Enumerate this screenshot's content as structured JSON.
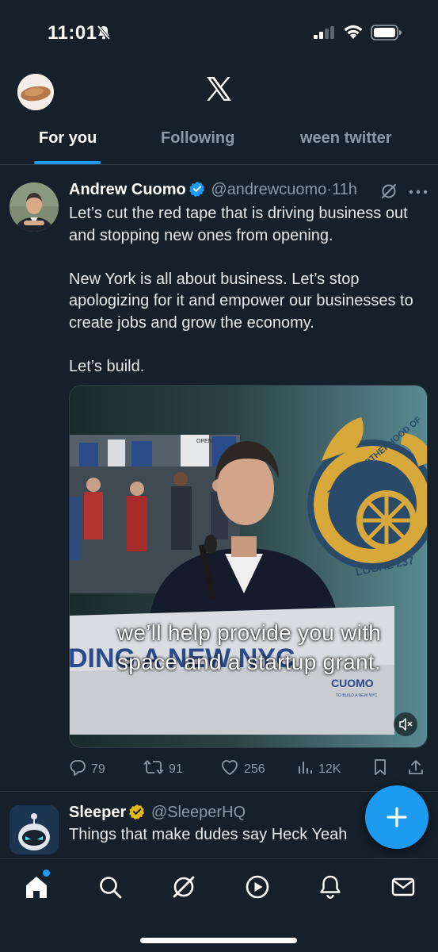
{
  "status_bar": {
    "time": "11:01"
  },
  "header": {
    "tabs": [
      {
        "label": "For you",
        "active": true
      },
      {
        "label": "Following",
        "active": false
      },
      {
        "label": "ween twitter",
        "active": false
      }
    ]
  },
  "tweet": {
    "name": "Andrew Cuomo",
    "handle": "@andrewcuomo",
    "separator": "·",
    "time": "11h",
    "body": "Let’s cut the red tape that is driving business out and stopping new ones from opening.\n\nNew York is all about business. Let’s stop apologizing for it and empower our businesses to create jobs and grow the economy.\n\nLet’s build.",
    "media": {
      "caption_line1": "we’ll help provide you with",
      "caption_line2": "space and a startup grant.",
      "sign_text": "DING A NEW NYC",
      "sign_brand": "CUOMO",
      "sign_tagline": "TO BUILD A NEW NYC",
      "seal_text": "TIONAL BROTHERHOOD OF",
      "seal_local": "LOCAL 237",
      "banner_text": "OPEN"
    },
    "stats": {
      "replies": "79",
      "reposts": "91",
      "likes": "256",
      "views": "12K"
    }
  },
  "tweet2": {
    "name": "Sleeper",
    "handle": "@SleeperHQ",
    "body": "Things that make dudes say Heck Yeah"
  },
  "colors": {
    "background": "#15202b",
    "accent": "#1d9bf0",
    "verified_blue": "#1d9bf0",
    "verified_gold": "#e2b719",
    "secondary_text": "#8b98a5"
  },
  "icons": {
    "status": [
      "bell-slash-icon",
      "signal-icon",
      "wifi-icon",
      "battery-icon"
    ],
    "nav": [
      "home-icon",
      "search-icon",
      "grok-icon",
      "video-icon",
      "notifications-icon",
      "messages-icon"
    ],
    "actions": [
      "reply-icon",
      "repost-icon",
      "like-icon",
      "views-icon",
      "bookmark-icon",
      "share-icon"
    ]
  }
}
